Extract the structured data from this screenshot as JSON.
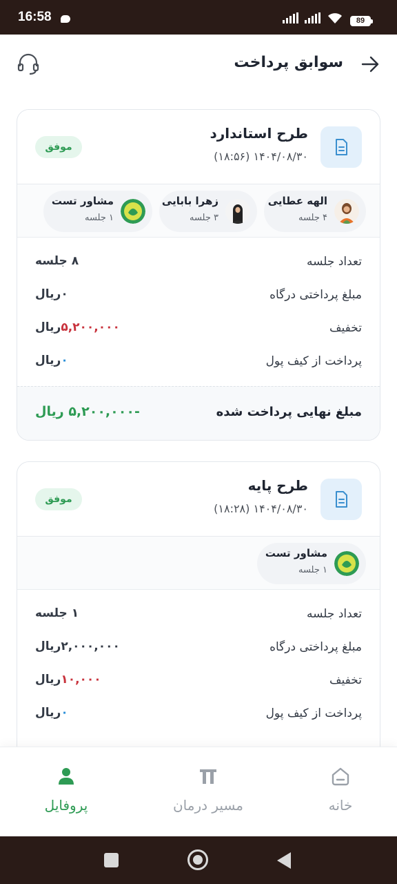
{
  "status_bar": {
    "time": "16:58",
    "battery": "89"
  },
  "header": {
    "title": "سوابق پرداخت",
    "back_icon": "arrow-right-icon",
    "support_icon": "headset-icon"
  },
  "payments": [
    {
      "plan_name": "طرح استاندارد",
      "date": "۱۴۰۴/۰۸/۳۰ (۱۸:۵۶)",
      "status": "موفق",
      "consultants": [
        {
          "name": "الهه عطایی",
          "sessions": "۴ جلسه"
        },
        {
          "name": "زهرا بابایی",
          "sessions": "۳ جلسه"
        },
        {
          "name": "مشاور تست",
          "sessions": "۱ جلسه"
        }
      ],
      "rows": [
        {
          "label": "تعداد جلسه",
          "value": "۸ جلسه"
        },
        {
          "label": "مبلغ پرداختی درگاه",
          "value": "۰",
          "unit": "ریال"
        },
        {
          "label": "تخفیف",
          "value": "۵,۲۰۰,۰۰۰",
          "unit": "ریال"
        },
        {
          "label": "پرداخت از کیف پول",
          "value": "۰",
          "unit": "ریال"
        }
      ],
      "total_label": "مبلغ نهایی پرداخت شده",
      "total_value": "-۵,۲۰۰,۰۰۰ ریال"
    },
    {
      "plan_name": "طرح پایه",
      "date": "۱۴۰۴/۰۸/۳۰ (۱۸:۲۸)",
      "status": "موفق",
      "consultants": [
        {
          "name": "مشاور تست",
          "sessions": "۱ جلسه"
        }
      ],
      "rows": [
        {
          "label": "تعداد جلسه",
          "value": "۱ جلسه"
        },
        {
          "label": "مبلغ پرداختی درگاه",
          "value": "۲,۰۰۰,۰۰۰",
          "unit": "ریال"
        },
        {
          "label": "تخفیف",
          "value": "۱۰,۰۰۰",
          "unit": "ریال"
        },
        {
          "label": "پرداخت از کیف پول",
          "value": "۰",
          "unit": "ریال"
        }
      ]
    }
  ],
  "bottom_nav": [
    {
      "label": "خانه",
      "icon": "home-icon",
      "active": false
    },
    {
      "label": "مسیر درمان",
      "icon": "path-icon",
      "active": false
    },
    {
      "label": "پروفایل",
      "icon": "user-icon",
      "active": true
    }
  ],
  "colors": {
    "accent_green": "#2e9b54",
    "discount_red": "#c8323c",
    "wallet_blue": "#2a8fd8"
  }
}
